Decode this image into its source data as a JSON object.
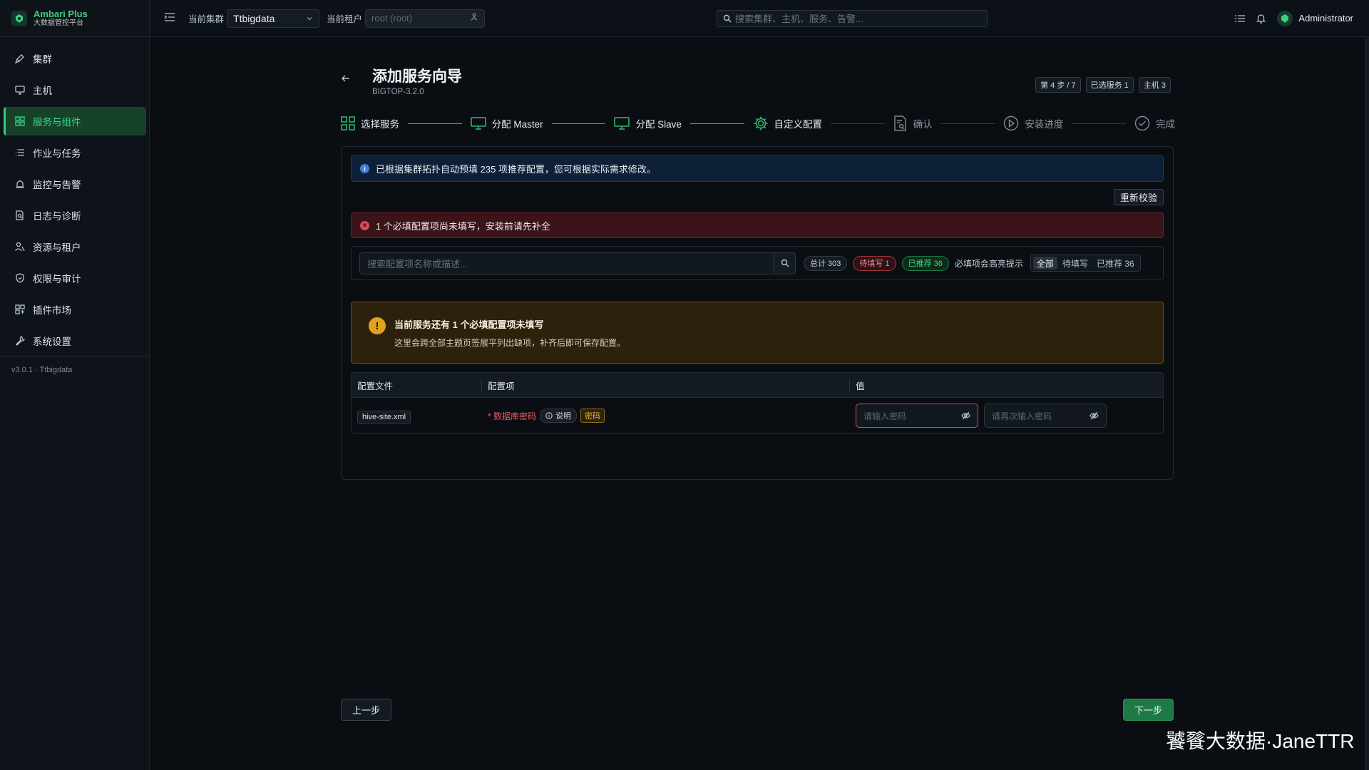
{
  "brand": {
    "title": "Ambari Plus",
    "subtitle": "大数据管控平台"
  },
  "sidebar": {
    "items": [
      {
        "label": "集群",
        "icon": "rocket-icon"
      },
      {
        "label": "主机",
        "icon": "monitor-icon"
      },
      {
        "label": "服务与组件",
        "icon": "grid-icon",
        "active": true
      },
      {
        "label": "作业与任务",
        "icon": "list-icon"
      },
      {
        "label": "监控与告警",
        "icon": "alarm-icon"
      },
      {
        "label": "日志与诊断",
        "icon": "file-search-icon"
      },
      {
        "label": "资源与租户",
        "icon": "users-icon"
      },
      {
        "label": "权限与审计",
        "icon": "shield-icon"
      },
      {
        "label": "插件市场",
        "icon": "puzzle-icon"
      },
      {
        "label": "系统设置",
        "icon": "wrench-icon"
      }
    ],
    "version": "v3.0.1 · Ttbigdata"
  },
  "topbar": {
    "cluster_label": "当前集群",
    "cluster_value": "Ttbigdata",
    "tenant_label": "当前租户",
    "tenant_placeholder": "root (root)",
    "search_placeholder": "搜索集群、主机、服务、告警...",
    "user": "Administrator"
  },
  "header": {
    "title": "添加服务向导",
    "subtitle": "BIGTOP-3.2.0",
    "chips": [
      "第 4 步 / 7",
      "已选服务 1",
      "主机 3"
    ]
  },
  "steps": [
    {
      "label": "选择服务",
      "status": "done"
    },
    {
      "label": "分配 Master",
      "status": "done"
    },
    {
      "label": "分配 Slave",
      "status": "done"
    },
    {
      "label": "自定义配置",
      "status": "current"
    },
    {
      "label": "确认",
      "status": "pending"
    },
    {
      "label": "安装进度",
      "status": "pending"
    },
    {
      "label": "完成",
      "status": "pending"
    }
  ],
  "alerts": {
    "info": "已根据集群拓扑自动预填 235 项推荐配置，您可根据实际需求修改。",
    "recheck": "重新校验",
    "error": "1 个必填配置项尚未填写，安装前请先补全"
  },
  "filter": {
    "search_placeholder": "搜索配置项名称或描述...",
    "total": "总计 303",
    "pending": "待填写 1",
    "recommended": "已推荐 36",
    "hint": "必填项会高亮提示",
    "segments": [
      "全部",
      "待填写",
      "已推荐 36"
    ]
  },
  "warning": {
    "title": "当前服务还有 1 个必填配置项未填写",
    "desc": "这里会跨全部主题页签展平列出缺项，补齐后即可保存配置。"
  },
  "table": {
    "headers": [
      "配置文件",
      "配置项",
      "值"
    ],
    "row": {
      "file": "hive-site.xml",
      "name": "* 数据库密码",
      "desc_tag": "说明",
      "type_tag": "密码",
      "password_placeholder": "请输入密码",
      "confirm_placeholder": "请再次输入密码"
    }
  },
  "footer": {
    "prev": "上一步",
    "next": "下一步"
  },
  "watermark": "饕餮大数据·JaneTTR",
  "colors": {
    "accent": "#35c979",
    "error": "#d84a55",
    "warning": "#e0a21f",
    "info": "#3d7fe0"
  }
}
